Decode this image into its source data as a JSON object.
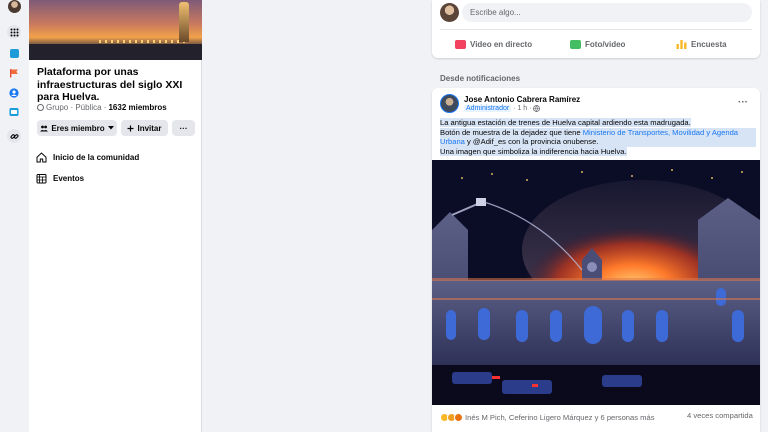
{
  "colors": {
    "accent": "#1877f2",
    "background": "#f0f2f5",
    "card": "#ffffff",
    "video_icon": "#f3425f",
    "photo_icon": "#45bd62",
    "poll_icon": "#f7b928"
  },
  "rail": {
    "icons": [
      "profile-avatar",
      "apps-grid-icon",
      "feed-icon",
      "flag-icon",
      "groups-icon",
      "watch-icon",
      "link-icon"
    ]
  },
  "group": {
    "title": "Plataforma por unas infraestructuras del siglo XXI para Huelva.",
    "meta_prefix": "Grupo · Pública ·",
    "members": "1632 miembros",
    "member_button": "Eres miembro",
    "invite_button": "Invitar",
    "more_button": "···",
    "nav": [
      {
        "label": "Inicio de la comunidad",
        "icon": "home-icon"
      },
      {
        "label": "Eventos",
        "icon": "calendar-icon"
      }
    ]
  },
  "composer": {
    "placeholder": "Escribe algo...",
    "actions": [
      {
        "label": "Video en directo",
        "icon": "live-video-icon"
      },
      {
        "label": "Foto/video",
        "icon": "photo-icon"
      },
      {
        "label": "Encuesta",
        "icon": "poll-icon"
      }
    ]
  },
  "feed": {
    "section_label": "Desde notificaciones"
  },
  "post": {
    "author": "Jose Antonio Cabrera Ramírez",
    "role": "Administrador",
    "time": "· 1 h ·",
    "more": "···",
    "line1": "La antigua estación de trenes de Huelva capital ardiendo esta madrugada.",
    "line2_a": "Botón de muestra de la dejadez que tiene ",
    "line2_link": "Ministerio de Transportes, Movilidad y Agenda Urbana",
    "line2_b": " y @Adif_es  con la provincia onubense.",
    "line3": "Una imagen que simboliza la indiferencia hacia  Huelva.",
    "reactions_text": "Inés M Pich, Ceferino Ligero Márquez y 6 personas más",
    "shares_text": "4 veces compartida"
  }
}
